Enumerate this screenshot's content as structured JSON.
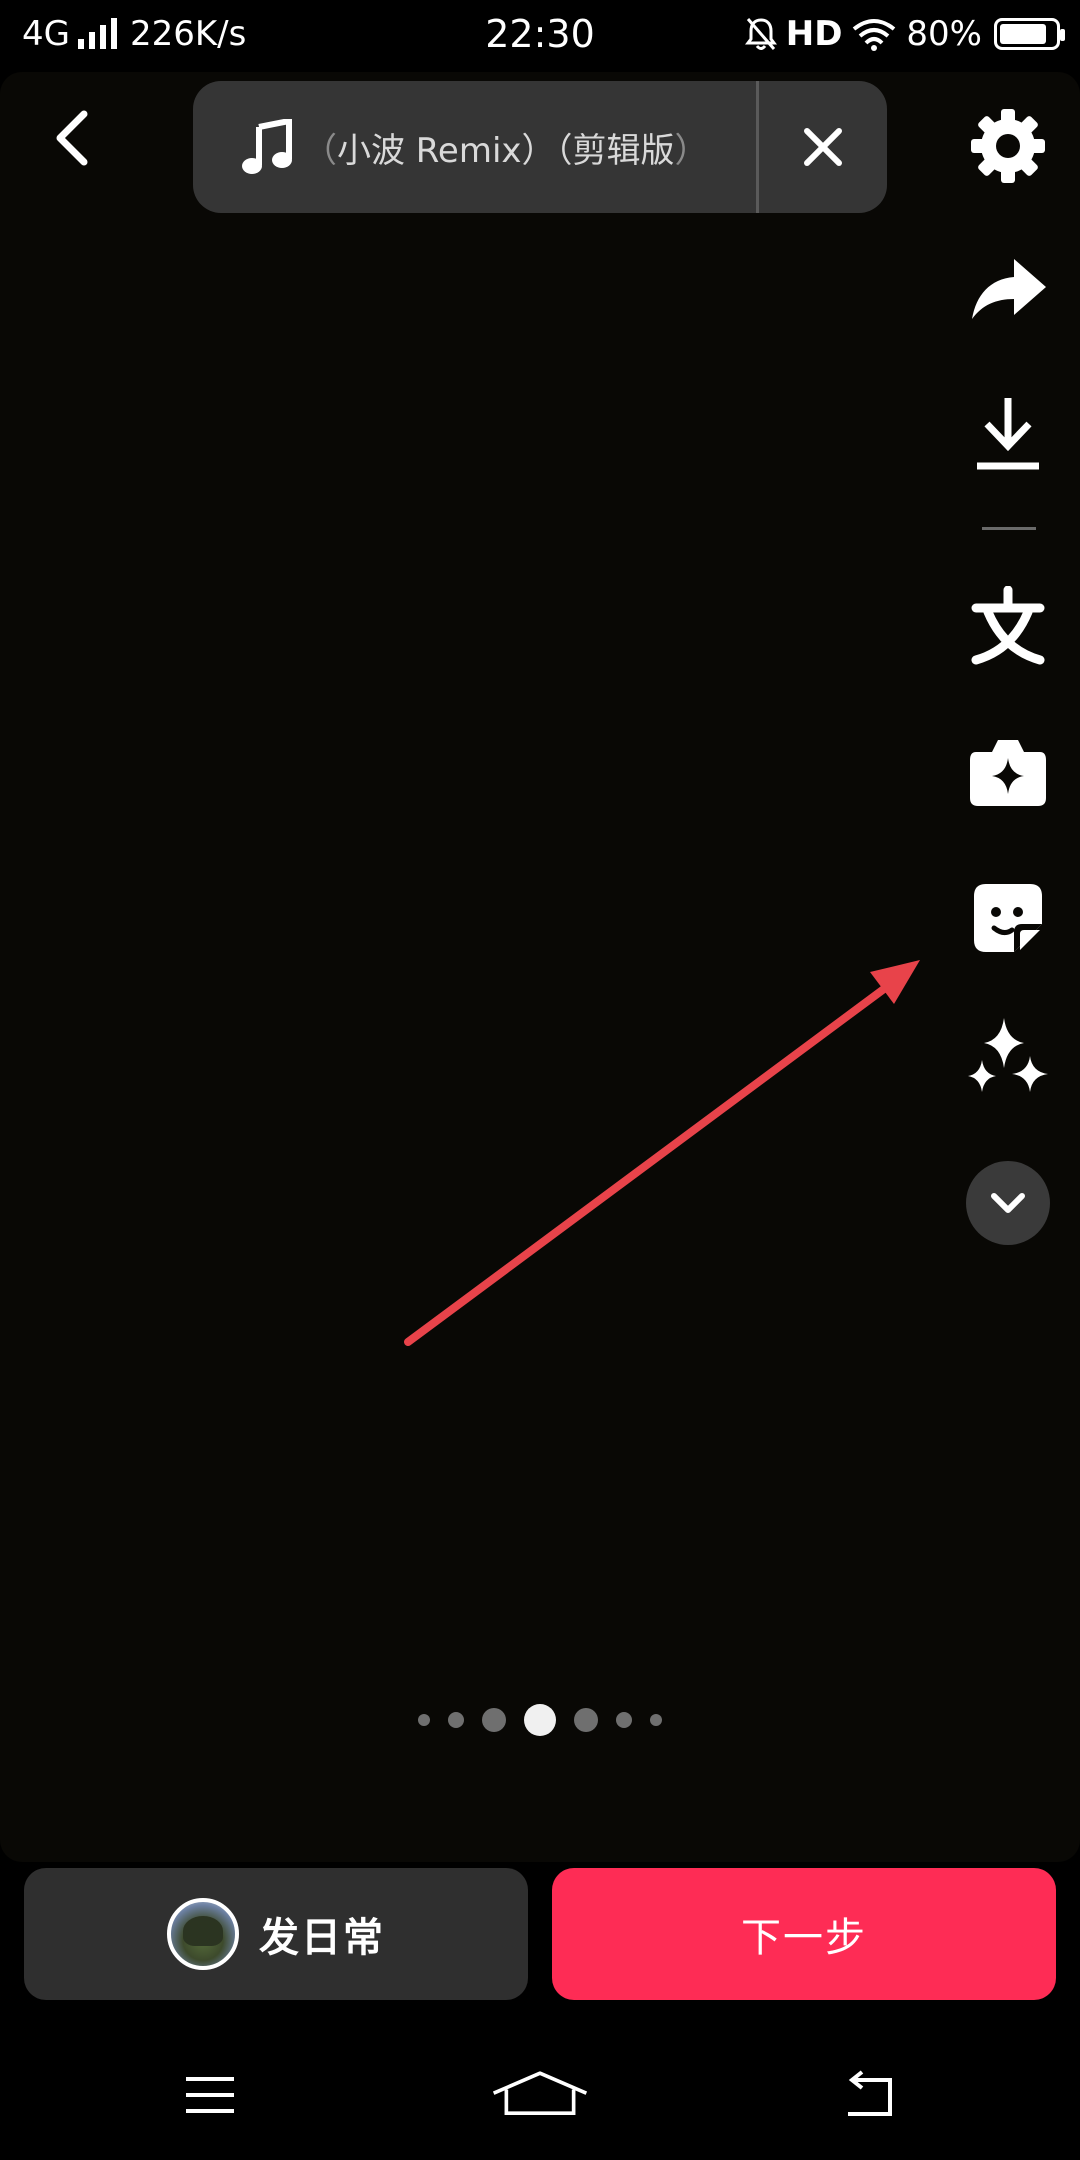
{
  "status_bar": {
    "network": "4G",
    "speed": "226K/s",
    "time": "22:30",
    "hd": "HD",
    "battery": "80%"
  },
  "music": {
    "prefix": "（",
    "title": "小波 Remix）（剪辑版",
    "suffix": "）"
  },
  "side_tools": [
    {
      "name": "settings",
      "icon": "gear-icon"
    },
    {
      "name": "share",
      "icon": "share-arrow-icon"
    },
    {
      "name": "download",
      "icon": "download-icon"
    },
    {
      "name": "text",
      "icon": "text-icon"
    },
    {
      "name": "effects",
      "icon": "sparkle-camera-icon"
    },
    {
      "name": "sticker",
      "icon": "sticker-icon"
    },
    {
      "name": "enhance",
      "icon": "sparkles-icon"
    },
    {
      "name": "expand",
      "icon": "chevron-down-icon"
    }
  ],
  "pagination": {
    "current": 4,
    "total": 7
  },
  "actions": {
    "daily_label": "发日常",
    "next_label": "下一步"
  },
  "colors": {
    "accent": "#fe2c55",
    "annotation": "#e8434a",
    "background": "#090805"
  }
}
